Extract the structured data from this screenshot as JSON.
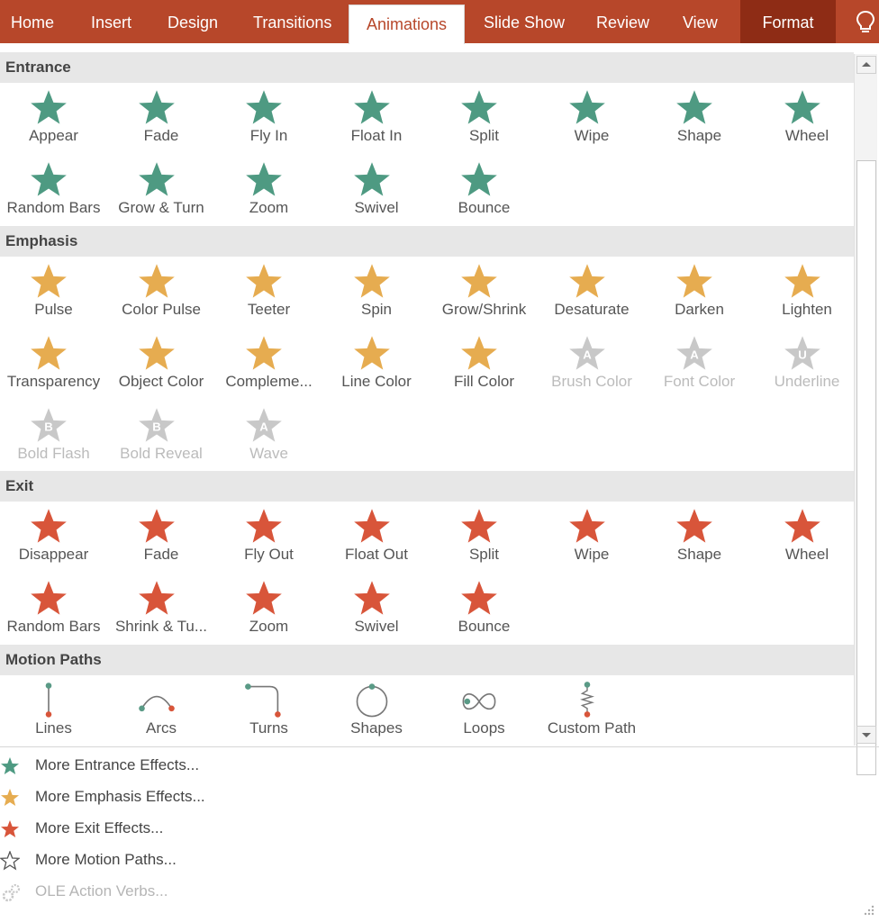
{
  "ribbon": {
    "tabs": [
      "Home",
      "Insert",
      "Design",
      "Transitions",
      "Animations",
      "Slide Show",
      "Review",
      "View",
      "Format"
    ],
    "active_tab": "Animations",
    "tell_me_icon": "lightbulb-icon"
  },
  "colors": {
    "ribbon": "#b7472a",
    "format_tab": "#8e2c15",
    "entrance": "#4e9a82",
    "emphasis": "#e6ac50",
    "exit": "#d8553a",
    "disabled": "#c8c8c8"
  },
  "gallery": {
    "sections": [
      {
        "title": "Entrance",
        "items": [
          {
            "label": "Appear",
            "icon": "appear-star-icon"
          },
          {
            "label": "Fade",
            "icon": "fade-star-icon"
          },
          {
            "label": "Fly In",
            "icon": "fly-in-star-icon"
          },
          {
            "label": "Float In",
            "icon": "float-in-star-icon"
          },
          {
            "label": "Split",
            "icon": "split-star-icon"
          },
          {
            "label": "Wipe",
            "icon": "wipe-star-icon"
          },
          {
            "label": "Shape",
            "icon": "shape-star-icon"
          },
          {
            "label": "Wheel",
            "icon": "wheel-star-icon"
          },
          {
            "label": "Random Bars",
            "icon": "random-bars-star-icon"
          },
          {
            "label": "Grow & Turn",
            "icon": "grow-turn-star-icon"
          },
          {
            "label": "Zoom",
            "icon": "zoom-star-icon"
          },
          {
            "label": "Swivel",
            "icon": "swivel-star-icon"
          },
          {
            "label": "Bounce",
            "icon": "bounce-star-icon"
          }
        ]
      },
      {
        "title": "Emphasis",
        "items": [
          {
            "label": "Pulse",
            "icon": "pulse-star-icon"
          },
          {
            "label": "Color Pulse",
            "icon": "color-pulse-star-icon"
          },
          {
            "label": "Teeter",
            "icon": "teeter-star-icon"
          },
          {
            "label": "Spin",
            "icon": "spin-star-icon"
          },
          {
            "label": "Grow/Shrink",
            "icon": "grow-shrink-star-icon"
          },
          {
            "label": "Desaturate",
            "icon": "desaturate-star-icon"
          },
          {
            "label": "Darken",
            "icon": "darken-star-icon"
          },
          {
            "label": "Lighten",
            "icon": "lighten-star-icon"
          },
          {
            "label": "Transparency",
            "icon": "transparency-star-icon"
          },
          {
            "label": "Object Color",
            "icon": "object-color-star-icon"
          },
          {
            "label": "Compleme...",
            "icon": "complementary-color-star-icon"
          },
          {
            "label": "Line Color",
            "icon": "line-color-star-icon"
          },
          {
            "label": "Fill Color",
            "icon": "fill-color-star-icon"
          },
          {
            "label": "Brush Color",
            "icon": "brush-color-star-icon",
            "disabled": true,
            "letter": "A"
          },
          {
            "label": "Font Color",
            "icon": "font-color-star-icon",
            "disabled": true,
            "letter": "A"
          },
          {
            "label": "Underline",
            "icon": "underline-star-icon",
            "disabled": true,
            "letter": "U"
          },
          {
            "label": "Bold Flash",
            "icon": "bold-flash-star-icon",
            "disabled": true,
            "letter": "B"
          },
          {
            "label": "Bold Reveal",
            "icon": "bold-reveal-star-icon",
            "disabled": true,
            "letter": "B"
          },
          {
            "label": "Wave",
            "icon": "wave-star-icon",
            "disabled": true,
            "letter": "A"
          }
        ]
      },
      {
        "title": "Exit",
        "items": [
          {
            "label": "Disappear",
            "icon": "disappear-star-icon"
          },
          {
            "label": "Fade",
            "icon": "fade-star-icon"
          },
          {
            "label": "Fly Out",
            "icon": "fly-out-star-icon"
          },
          {
            "label": "Float Out",
            "icon": "float-out-star-icon"
          },
          {
            "label": "Split",
            "icon": "split-star-icon"
          },
          {
            "label": "Wipe",
            "icon": "wipe-star-icon"
          },
          {
            "label": "Shape",
            "icon": "shape-star-icon"
          },
          {
            "label": "Wheel",
            "icon": "wheel-star-icon"
          },
          {
            "label": "Random Bars",
            "icon": "random-bars-star-icon"
          },
          {
            "label": "Shrink & Tu...",
            "icon": "shrink-turn-star-icon"
          },
          {
            "label": "Zoom",
            "icon": "zoom-star-icon"
          },
          {
            "label": "Swivel",
            "icon": "swivel-star-icon"
          },
          {
            "label": "Bounce",
            "icon": "bounce-star-icon"
          }
        ]
      },
      {
        "title": "Motion Paths",
        "items": [
          {
            "label": "Lines",
            "icon": "line-path-icon"
          },
          {
            "label": "Arcs",
            "icon": "arc-path-icon"
          },
          {
            "label": "Turns",
            "icon": "turn-path-icon"
          },
          {
            "label": "Shapes",
            "icon": "shape-path-icon"
          },
          {
            "label": "Loops",
            "icon": "loop-path-icon"
          },
          {
            "label": "Custom Path",
            "icon": "custom-path-icon"
          }
        ]
      }
    ]
  },
  "more_links": [
    {
      "label": "More Entrance Effects...",
      "icon": "green-star-icon"
    },
    {
      "label": "More Emphasis Effects...",
      "icon": "yellow-star-icon"
    },
    {
      "label": "More Exit Effects...",
      "icon": "red-star-icon"
    },
    {
      "label": "More Motion Paths...",
      "icon": "outline-star-icon"
    },
    {
      "label": "OLE Action Verbs...",
      "icon": "gears-icon",
      "disabled": true
    }
  ]
}
